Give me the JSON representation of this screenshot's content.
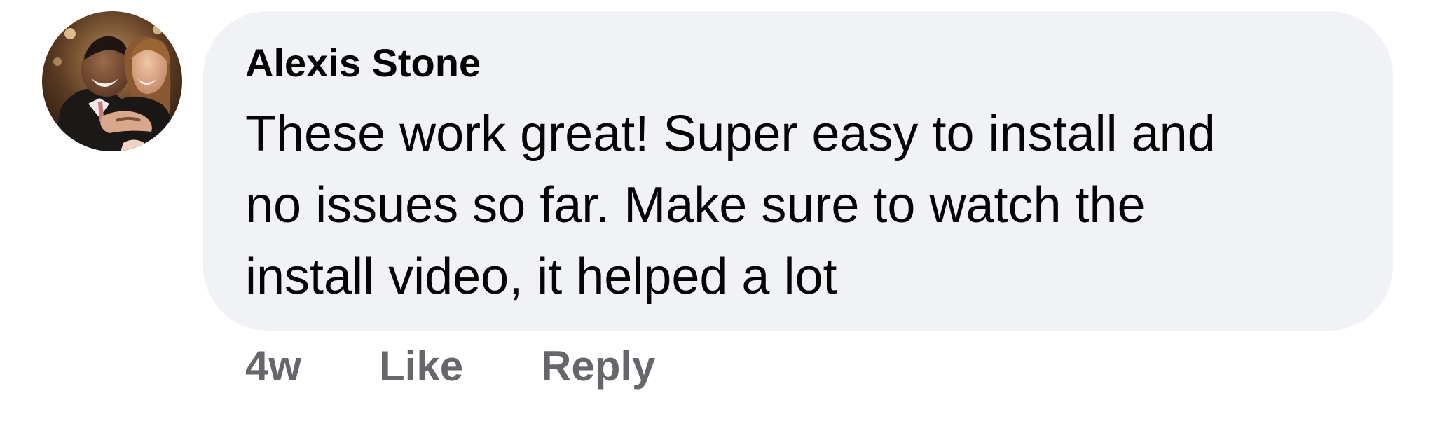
{
  "comment": {
    "author": "Alexis Stone",
    "lines": [
      "These work great! Super easy to install and",
      "no issues so far. Make sure to watch the",
      "install video, it helped a lot"
    ],
    "timestamp": "4w",
    "like_label": "Like",
    "reply_label": "Reply"
  },
  "colors": {
    "bubble_background": "#f0f2f5",
    "primary_text": "#050505",
    "secondary_text": "#65676b"
  },
  "icons": {
    "avatar": "user-avatar-photo"
  }
}
